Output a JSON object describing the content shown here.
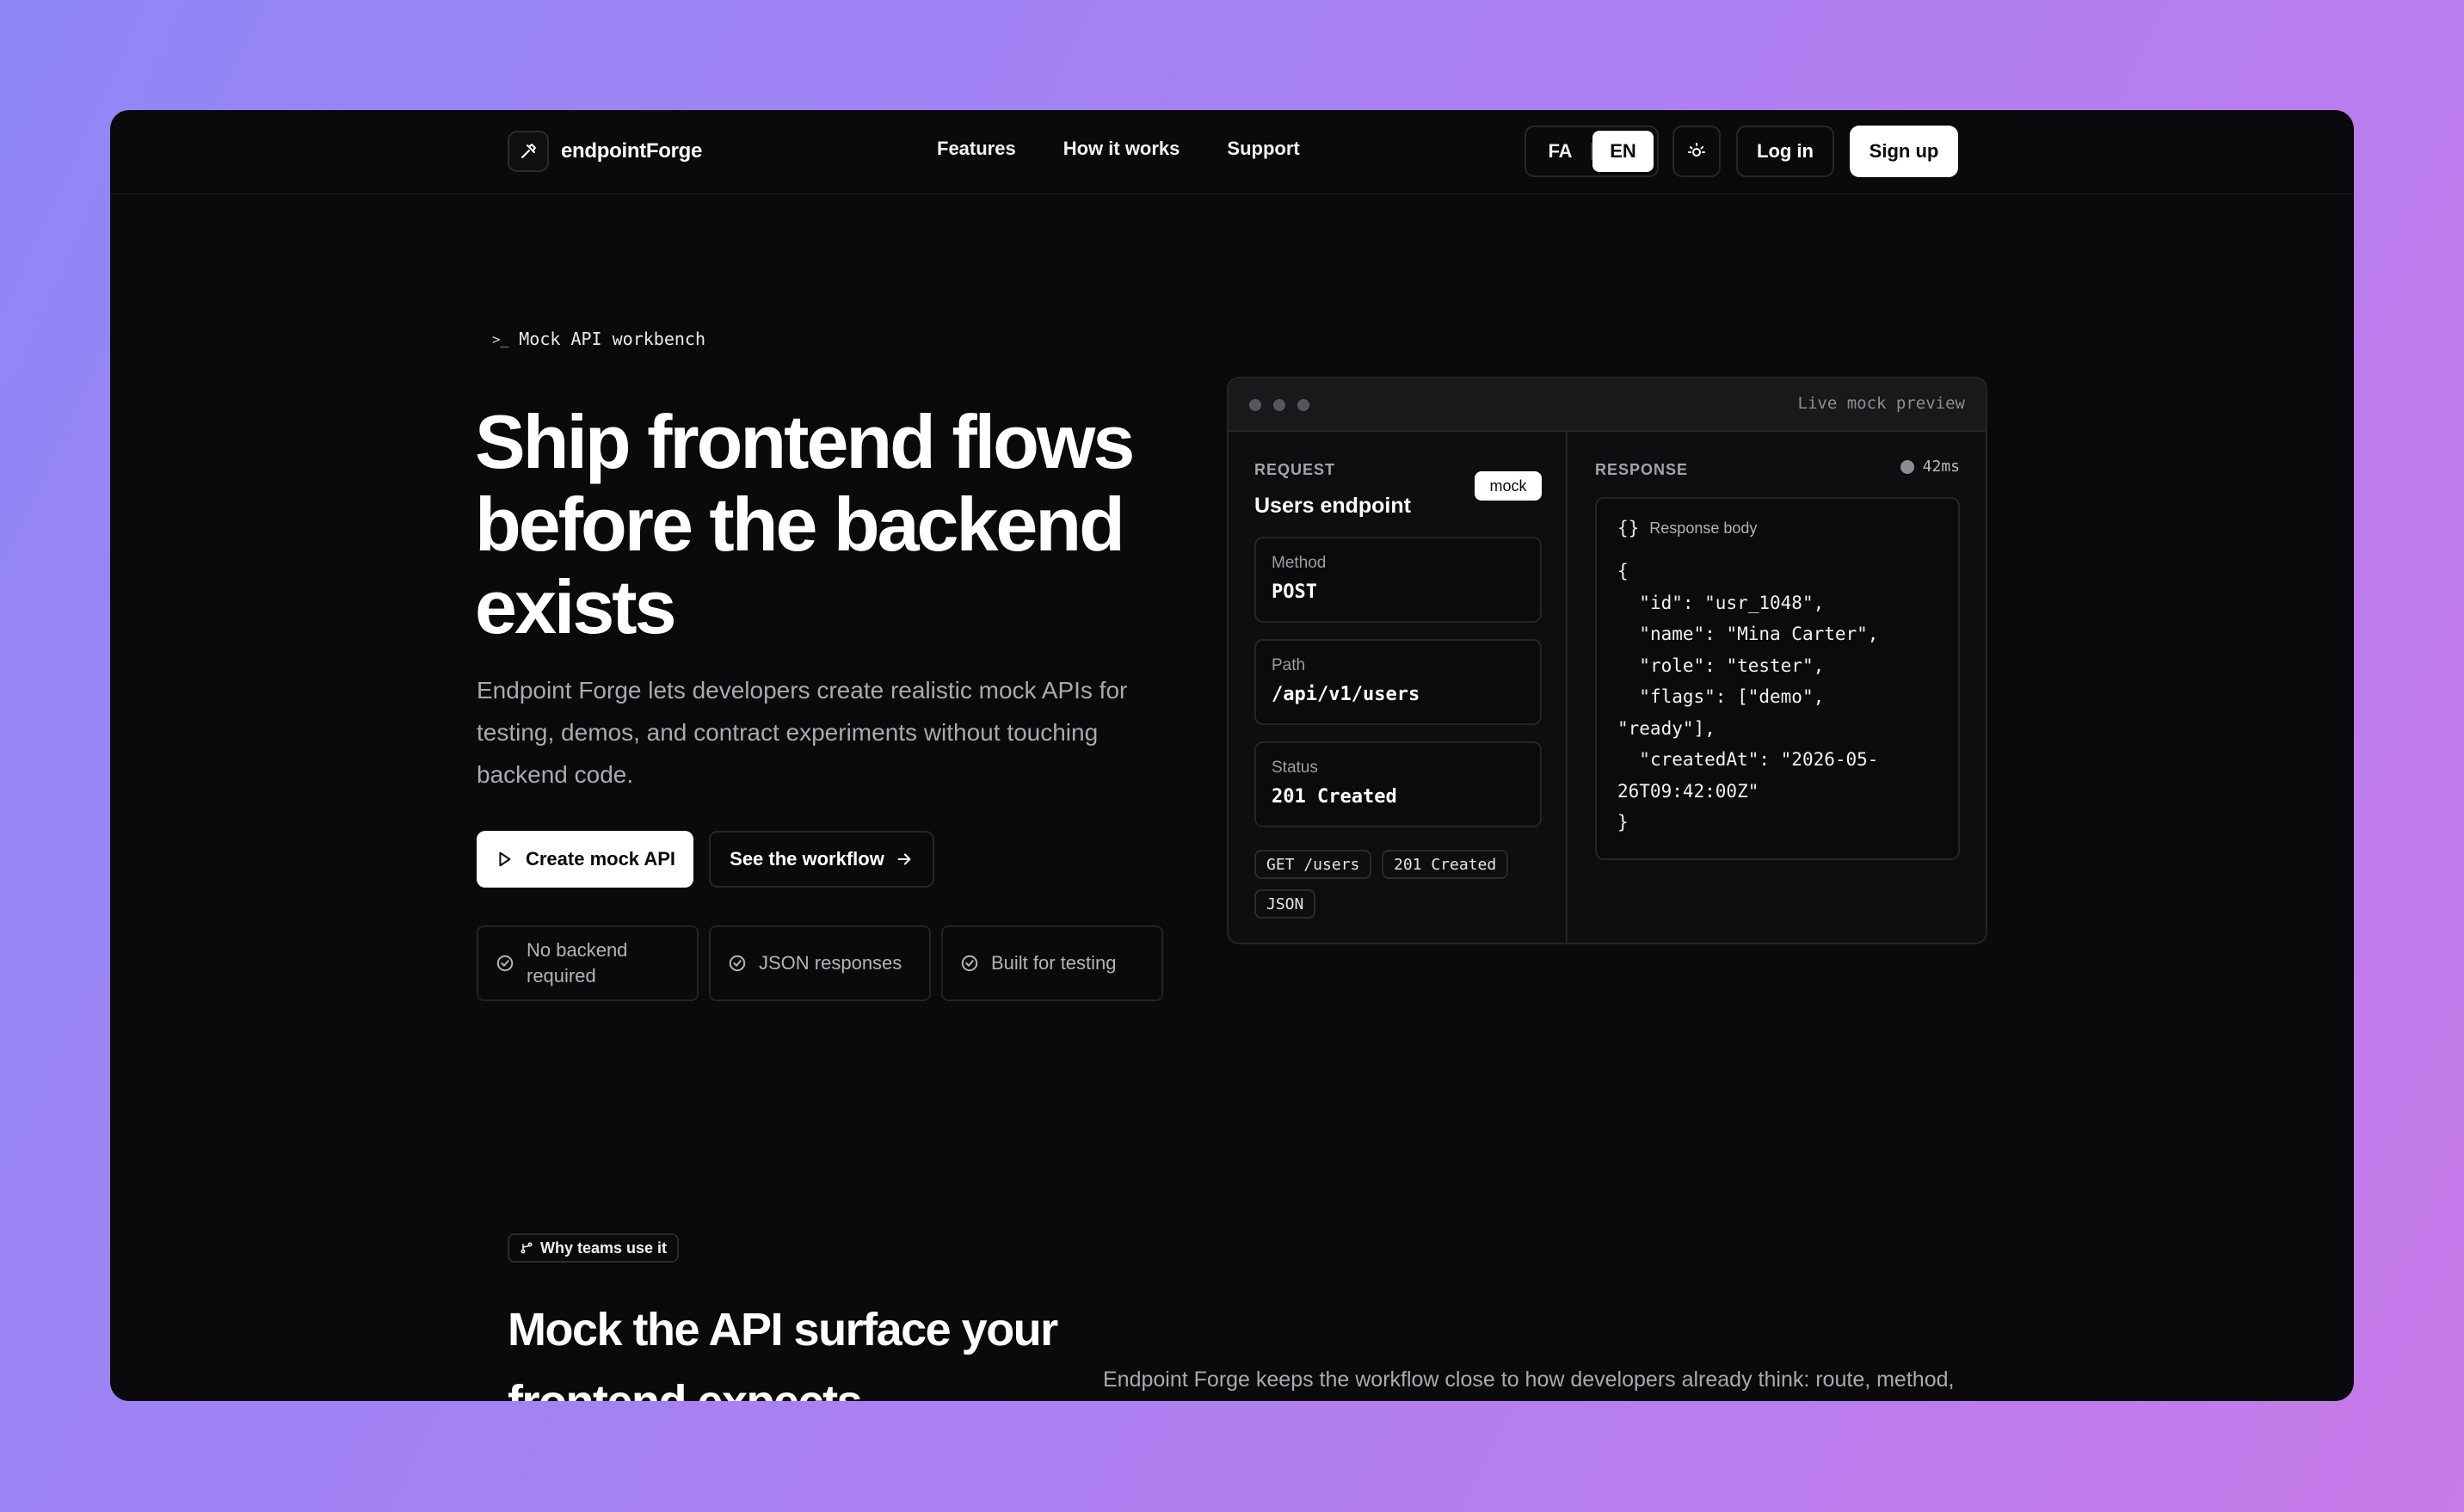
{
  "nav": {
    "brand": "endpointForge",
    "links": [
      "Features",
      "How it works",
      "Support"
    ],
    "lang_options": [
      "FA",
      "EN"
    ],
    "lang_active": "EN",
    "login": "Log in",
    "signup": "Sign up"
  },
  "hero": {
    "eyebrow": "Mock API workbench",
    "title": "Ship frontend flows before the backend exists",
    "description": "Endpoint Forge lets developers create realistic mock APIs for testing, demos, and contract experiments without touching backend code.",
    "primary_cta": "Create mock API",
    "secondary_cta": "See the workflow",
    "features": [
      "No backend required",
      "JSON responses",
      "Built for testing"
    ]
  },
  "preview": {
    "label": "Live mock preview",
    "request": {
      "caption": "REQUEST",
      "title": "Users endpoint",
      "badge": "mock",
      "method_label": "Method",
      "method": "POST",
      "path_label": "Path",
      "path": "/api/v1/users",
      "status_label": "Status",
      "status": "201 Created",
      "chips": [
        "GET /users",
        "201 Created",
        "JSON"
      ]
    },
    "response": {
      "caption": "RESPONSE",
      "latency": "42ms",
      "body_label": "Response body",
      "body": "{\n  \"id\": \"usr_1048\",\n  \"name\": \"Mina Carter\",\n  \"role\": \"tester\",\n  \"flags\": [\"demo\",\n\"ready\"],\n  \"createdAt\": \"2026-05-\n26T09:42:00Z\"\n}"
    }
  },
  "section": {
    "tag": "Why teams use it",
    "title": "Mock the API surface your frontend expects",
    "description": "Endpoint Forge keeps the workflow close to how developers already think: route, method,"
  }
}
